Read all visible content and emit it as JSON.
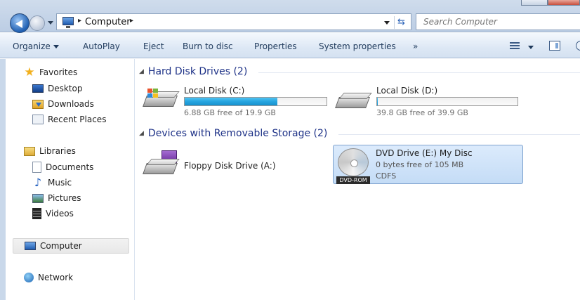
{
  "address_bar": {
    "crumb": "Computer",
    "separator": "▸"
  },
  "search": {
    "placeholder": "Search Computer"
  },
  "toolbar": {
    "organize": "Organize",
    "autoplay": "AutoPlay",
    "eject": "Eject",
    "burn": "Burn to disc",
    "properties": "Properties",
    "system_properties": "System properties",
    "more": "»"
  },
  "nav": {
    "favorites": "Favorites",
    "desktop": "Desktop",
    "downloads": "Downloads",
    "recent": "Recent Places",
    "libraries": "Libraries",
    "documents": "Documents",
    "music": "Music",
    "pictures": "Pictures",
    "videos": "Videos",
    "computer": "Computer",
    "network": "Network"
  },
  "groups": {
    "hdd": "Hard Disk Drives (2)",
    "removable": "Devices with Removable Storage (2)"
  },
  "drives": {
    "c": {
      "name": "Local Disk (C:)",
      "free": "6.88 GB free of 19.9 GB",
      "used_fraction": 0.654
    },
    "d": {
      "name": "Local Disk (D:)",
      "free": "39.8 GB free of 39.9 GB",
      "used_fraction": 0.003
    },
    "floppy": {
      "name": "Floppy Disk Drive (A:)"
    },
    "dvd": {
      "name": "DVD Drive (E:) My Disc",
      "free": "0 bytes free of 105 MB",
      "fs": "CDFS",
      "badge": "DVD-ROM"
    }
  },
  "colors": {
    "accent": "#1e3287",
    "bar_fill": "#27a5e0",
    "selection": "#c4dcf6"
  }
}
